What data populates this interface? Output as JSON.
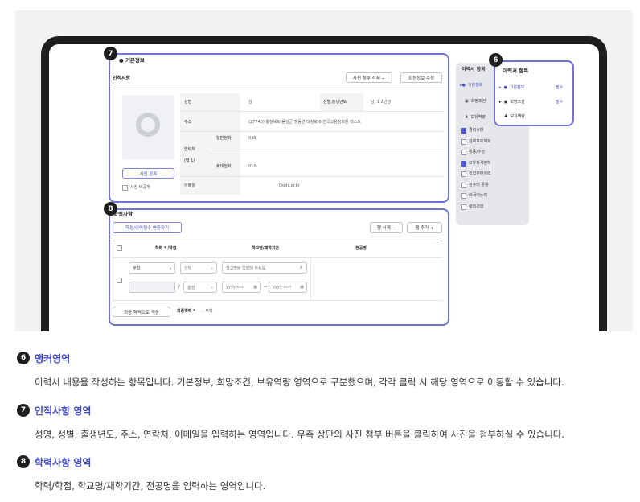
{
  "basic": {
    "title": "기본정보",
    "subtitle": "인적사항",
    "photo_attach_btn": "사진 첨부 삭제 −",
    "member_edit_btn": "회원정보 수정",
    "photo_register_btn": "사진 등록",
    "photo_private_label": "사진 비공개",
    "rows": {
      "name_label": "성명",
      "name_value": "김",
      "gender_label": "성별,출생년도",
      "gender_value": "남, 1    2년생",
      "address_label": "주소",
      "address_value": "(27740) 충청북도 음성군 맹동면 태정로 6 한국고용정보원 테스트",
      "contact_label": "연락처",
      "contact_sub": "(택 1)",
      "phone_label": "일반전화",
      "phone_value": "043-",
      "mobile_label": "휴대전화",
      "mobile_value": "010-",
      "email_label": "이메일",
      "email_value": "0kels.or.kr"
    }
  },
  "edu": {
    "title": "학력사항",
    "convert_btn": "학점/이력점수 변환하기",
    "row_delete_btn": "행 삭제 −",
    "row_add_btn": "행 추가 +",
    "col_degree": "학력 * /학점",
    "col_school": "학교명/재학기간",
    "col_major": "전공명",
    "degree_select": "무학",
    "choice_select": "선택",
    "school_placeholder": "학교명을 입력해 주세요.",
    "slash": "/",
    "score_select": "총점",
    "date_placeholder": "yyyy-mm",
    "dash": "−",
    "final_btn": "최종 학력으로 적용",
    "final_label": "최종학력 *",
    "final_value": ": 무학"
  },
  "side": {
    "title": "이력서 항목",
    "items": [
      "기본정보",
      "희망조건",
      "보유역량"
    ],
    "required": "필수",
    "checklist": [
      {
        "label": "경력사항",
        "checked": true
      },
      {
        "label": "참여프로젝트",
        "checked": false
      },
      {
        "label": "활동/수상",
        "checked": false
      },
      {
        "label": "보유자격면허",
        "checked": true
      },
      {
        "label": "직업훈련이력",
        "checked": false
      },
      {
        "label": "컴퓨터 활용",
        "checked": false
      },
      {
        "label": "외국어능력",
        "checked": false
      },
      {
        "label": "해외경험",
        "checked": false
      }
    ]
  },
  "badges": {
    "anchor": "6",
    "personal": "7",
    "education": "8"
  },
  "descriptions": [
    {
      "num": "6",
      "title": "앵커영역",
      "text": "이력서 내용을 작성하는 항목입니다. 기본정보, 희망조건, 보유역량 영역으로 구분했으며, 각각 클릭 시 해당 영역으로 이동할 수 있습니다."
    },
    {
      "num": "7",
      "title": "인적사항 영역",
      "text": "성명, 성별, 출생년도, 주소, 연락처, 이메일을 입력하는 영역입니다. 우측 상단의 사진 첨부 버튼을 클릭하여 사진을 첨부하실 수 있습니다."
    },
    {
      "num": "8",
      "title": "학력사항 영역",
      "text": "학력/학점, 학교명/재학기간, 전공명을 입력하는 영역입니다."
    }
  ],
  "colors": {
    "accent": "#6e74d8",
    "heading": "#3e47c4",
    "checked": "#4f58d6"
  }
}
